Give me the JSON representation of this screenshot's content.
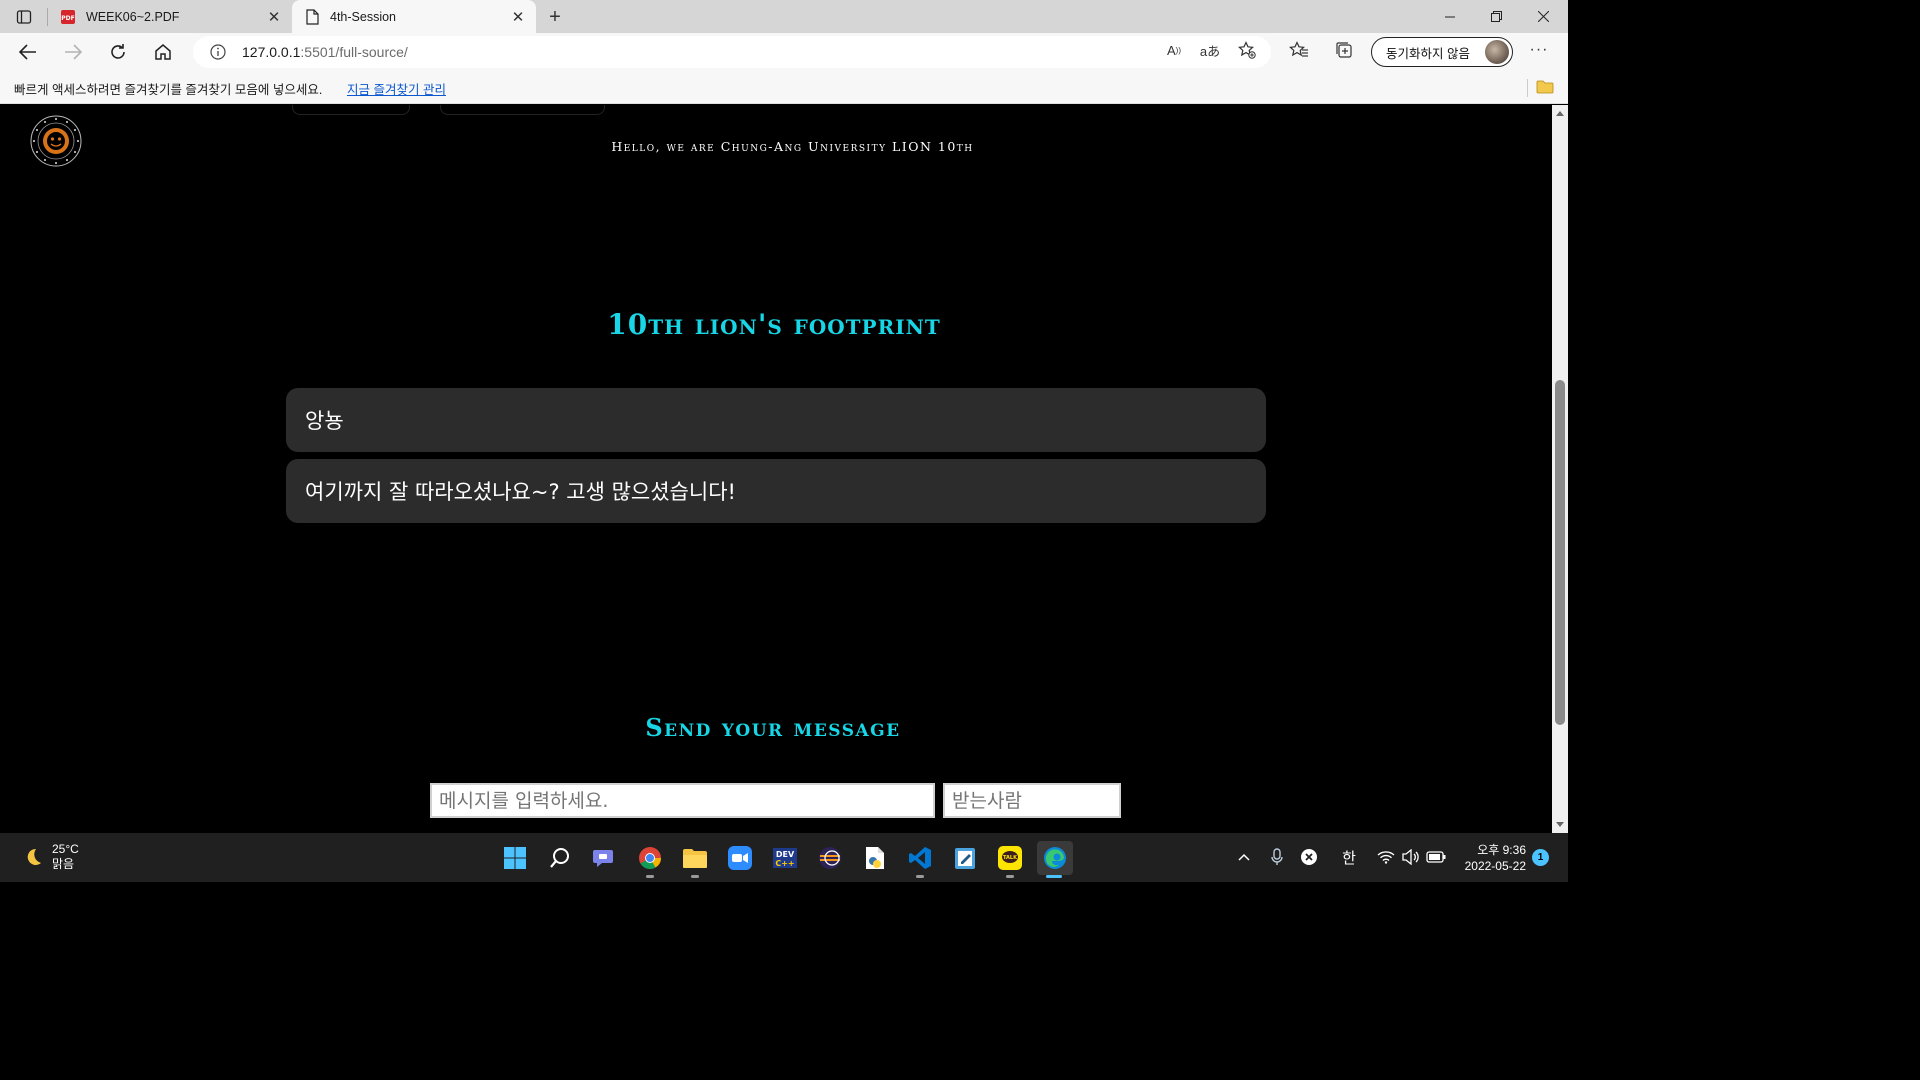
{
  "browser": {
    "tabs": [
      {
        "label": "WEEK06~2.PDF",
        "icon": "pdf-icon",
        "active": false
      },
      {
        "label": "4th-Session",
        "icon": "document-icon",
        "active": true
      }
    ],
    "address": {
      "host": "127.0.0.1",
      "path": ":5501/full-source/"
    },
    "profile_label": "동기화하지 않음",
    "favorites_bar": {
      "message": "빠르게 액세스하려면 즐겨찾기를 즐겨찾기 모음에 넣으세요.",
      "link": "지금 즐겨찾기 관리"
    }
  },
  "page": {
    "header_text": "Hello, we are Chung-Ang University LION 10th",
    "footprint_title": "10th lion's footprint",
    "messages": [
      "앙뇽",
      "여기까지 잘 따라오셨나요~? 고생 많으셨습니다!"
    ],
    "send_title": "Send your message",
    "message_input_placeholder": "메시지를 입력하세요.",
    "recipient_input_placeholder": "받는사람",
    "colors": {
      "accent": "#18d6e6",
      "card": "#2c2c2c",
      "background": "#000000"
    }
  },
  "taskbar": {
    "weather_temp": "25°C",
    "weather_desc": "맑음",
    "ime": "한",
    "time": "오후 9:36",
    "date": "2022-05-22",
    "notification_count": "1"
  }
}
